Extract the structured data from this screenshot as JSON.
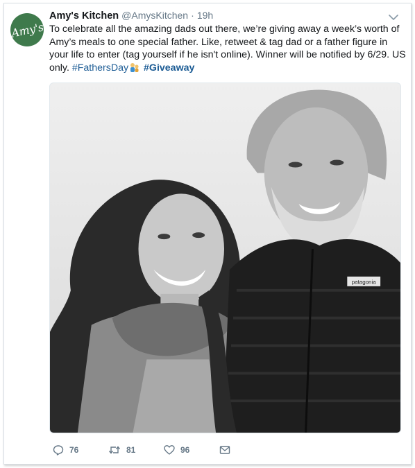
{
  "author": {
    "name": "Amy's Kitchen",
    "handle": "@AmysKitchen",
    "separator": "·",
    "time": "19h",
    "avatar_text": "Amy's"
  },
  "tweet": {
    "text_main": "To celebrate all the amazing dads out there, we’re giving away a week’s worth of Amy’s meals to one special father. Like, retweet & tag dad or a father figure in your life to enter (tag yourself if he isn't online). Winner will be notified by 6/29. US only. ",
    "hashtag_1": "#FathersDay",
    "hashtag_2": "#Giveaway",
    "jacket_logo": "patagonia"
  },
  "actions": {
    "replies": "76",
    "retweets": "81",
    "likes": "96"
  },
  "icons": {
    "reply": "reply-icon",
    "retweet": "retweet-icon",
    "like": "heart-icon",
    "dm": "envelope-icon",
    "caret": "chevron-down-icon"
  },
  "colors": {
    "avatar_bg": "#3f7a4c",
    "hashtag": "#1b5b94",
    "meta": "#657786"
  }
}
